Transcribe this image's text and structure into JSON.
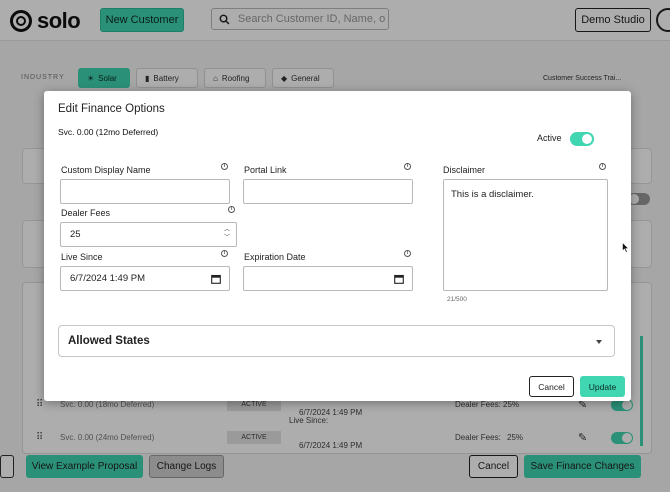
{
  "header": {
    "logo_text": "solo",
    "new_customer_label": "New Customer",
    "search_placeholder": "Search Customer ID, Name, or Proj",
    "studio_label": "Demo Studio"
  },
  "industry": {
    "label": "INDUSTRY",
    "tabs": [
      {
        "label": "Solar",
        "icon": "sun-icon",
        "active": true
      },
      {
        "label": "Battery",
        "icon": "battery-icon",
        "active": false
      },
      {
        "label": "Roofing",
        "icon": "home-icon",
        "active": false
      },
      {
        "label": "General",
        "icon": "layers-icon",
        "active": false
      }
    ],
    "user_label": "Customer Success Trai..."
  },
  "background_rows": [
    {
      "text": "Svc. 0.00 (18mo Deferred)",
      "status": "ACTIVE",
      "date": "6/7/2024 1:49 PM",
      "dealer_fees": "Dealer Fees:  25%"
    },
    {
      "text": "Svc. 0.00 (24mo Deferred)",
      "status": "ACTIVE",
      "date": "6/7/2024 1:49 PM",
      "live_since": "Live Since:",
      "dealer_fees": "Dealer Fees:",
      "dealer_value": "25%"
    }
  ],
  "bottom_bar": {
    "view_example": "View Example Proposal",
    "change_logs": "Change Logs",
    "cancel": "Cancel",
    "save": "Save Finance Changes"
  },
  "modal": {
    "title": "Edit Finance Options",
    "subtitle": "Svc. 0.00 (12mo Deferred)",
    "active_label": "Active",
    "active": true,
    "fields": {
      "custom_display_name": {
        "label": "Custom Display Name",
        "value": ""
      },
      "portal_link": {
        "label": "Portal Link",
        "value": ""
      },
      "dealer_fees": {
        "label": "Dealer Fees",
        "value": "25"
      },
      "live_since": {
        "label": "Live Since",
        "value": "6/7/2024 1:49 PM"
      },
      "expiration_date": {
        "label": "Expiration Date",
        "value": ""
      },
      "disclaimer": {
        "label": "Disclaimer",
        "value": "This is a disclaimer.",
        "count": "21/500"
      }
    },
    "allowed_states_label": "Allowed States",
    "cancel_label": "Cancel",
    "update_label": "Update"
  },
  "colors": {
    "accent": "#3fd6b1",
    "overlay": "rgba(0,0,0,0.32)"
  }
}
